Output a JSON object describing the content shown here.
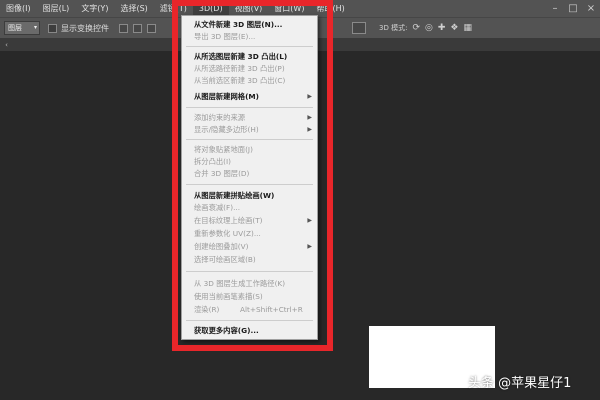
{
  "menubar": {
    "items": [
      "图像(I)",
      "图层(L)",
      "文字(Y)",
      "选择(S)",
      "滤镜(T)",
      "3D(D)",
      "视图(V)",
      "窗口(W)",
      "帮助(H)"
    ],
    "win_controls": [
      "minimize-icon",
      "restore-icon",
      "close-icon"
    ]
  },
  "options": {
    "layer_select": "图层",
    "show_transform_label": "显示变换控件",
    "mode_label": "3D 模式:"
  },
  "dropdown": {
    "items": [
      {
        "label": "从文件新建 3D 图层(N)...",
        "enabled": true
      },
      {
        "label": "导出 3D 图层(E)...",
        "enabled": false
      },
      {
        "label": "从所选图层新建 3D 凸出(L)",
        "enabled": true
      },
      {
        "label": "从所选路径新建 3D 凸出(P)",
        "enabled": false
      },
      {
        "label": "从当前选区新建 3D 凸出(C)",
        "enabled": false
      },
      {
        "label": "从图层新建网格(M)",
        "enabled": true,
        "submenu": true
      },
      {
        "label": "添加约束的来源",
        "enabled": false,
        "submenu": true
      },
      {
        "label": "显示/隐藏多边形(H)",
        "enabled": false,
        "submenu": true
      },
      {
        "label": "将对象贴紧地面(J)",
        "enabled": false
      },
      {
        "label": "拆分凸出(I)",
        "enabled": false
      },
      {
        "label": "合并 3D 图层(D)",
        "enabled": false
      },
      {
        "label": "从图层新建拼贴绘画(W)",
        "enabled": true
      },
      {
        "label": "绘画衰减(F)...",
        "enabled": false
      },
      {
        "label": "在目标纹理上绘画(T)",
        "enabled": false,
        "submenu": true
      },
      {
        "label": "重新参数化 UV(Z)...",
        "enabled": false
      },
      {
        "label": "创建绘图叠加(V)",
        "enabled": false,
        "submenu": true
      },
      {
        "label": "选择可绘画区域(B)",
        "enabled": false
      },
      {
        "label": "从 3D 图层生成工作路径(K)",
        "enabled": false
      },
      {
        "label": "使用当前画笔素描(S)",
        "enabled": false
      },
      {
        "label": "渲染(R)",
        "enabled": false,
        "shortcut": "Alt+Shift+Ctrl+R"
      },
      {
        "label": "获取更多内容(G)...",
        "enabled": true
      }
    ]
  },
  "watermark": "头条 @苹果星仔1",
  "colors": {
    "highlight_frame": "#e8262a",
    "menubar_bg": "#535353",
    "workspace_bg": "#282828",
    "menu_bg": "#f0f0f0"
  }
}
